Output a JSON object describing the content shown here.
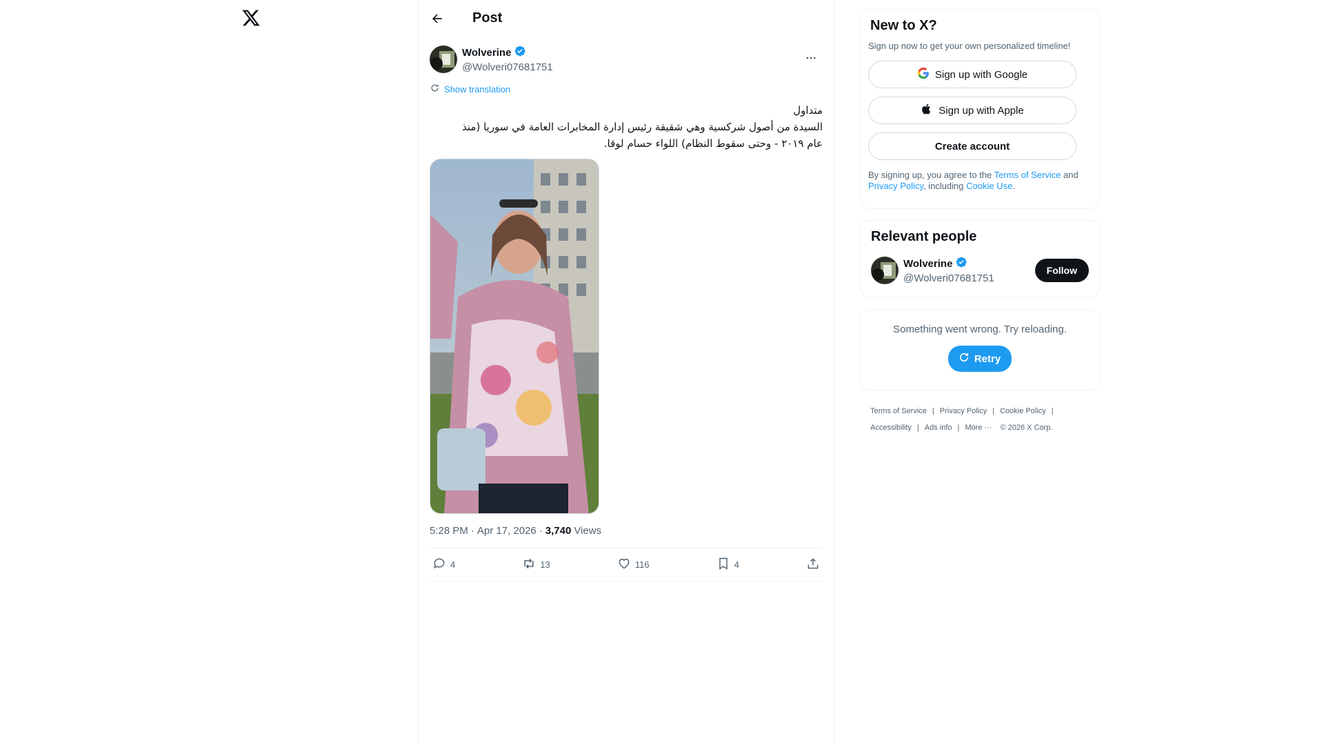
{
  "nav": {
    "logo_icon": "x-logo-icon"
  },
  "header": {
    "title": "Post",
    "back_icon": "arrow-left-icon"
  },
  "post": {
    "author_name": "Wolverine",
    "author_handle": "@Wolveri07681751",
    "verified_icon": "verified-badge-icon",
    "more_icon": "more-dots-icon",
    "translation_label": "Show translation",
    "text_lines": [
      "متداول",
      "السيدة من أصول شركسية وهي شقيقة رئيس إدارة المخابرات العامة في سوريا (منذ",
      "عام ٢٠١٩ - وحتى سقوط النظام) اللواء حسام لوقا."
    ],
    "time": "5:28 PM",
    "date": "Apr 17, 2026",
    "dot": "·",
    "views_count": "3,740",
    "views_label": "Views",
    "actions": {
      "replies": "4",
      "reposts": "13",
      "likes": "116",
      "bookmarks": "4"
    }
  },
  "signup": {
    "title": "New to X?",
    "subtitle": "Sign up now to get your own personalized timeline!",
    "google": "Sign up with Google",
    "apple": "Sign up with Apple",
    "create": "Create account",
    "legal_pre": "By signing up, you agree to the ",
    "terms": "Terms of Service",
    "and": " and",
    "privacy": "Privacy Policy",
    "including": ", including ",
    "cookie": "Cookie Use",
    "period": "."
  },
  "people": {
    "title": "Relevant people",
    "name": "Wolverine",
    "handle": "@Wolveri07681751",
    "follow": "Follow"
  },
  "error": {
    "message": "Something went wrong. Try reloading.",
    "retry": "Retry"
  },
  "footer": {
    "terms": "Terms of Service",
    "privacy": "Privacy Policy",
    "cookie": "Cookie Policy",
    "accessibility": "Accessibility",
    "ads": "Ads info",
    "more": "More ···",
    "copyright": "© 2026 X Corp.",
    "separator": "|"
  },
  "colors": {
    "accent": "#1d9bf0",
    "text": "#0f1419",
    "muted": "#536471",
    "border": "#eff3f4"
  }
}
